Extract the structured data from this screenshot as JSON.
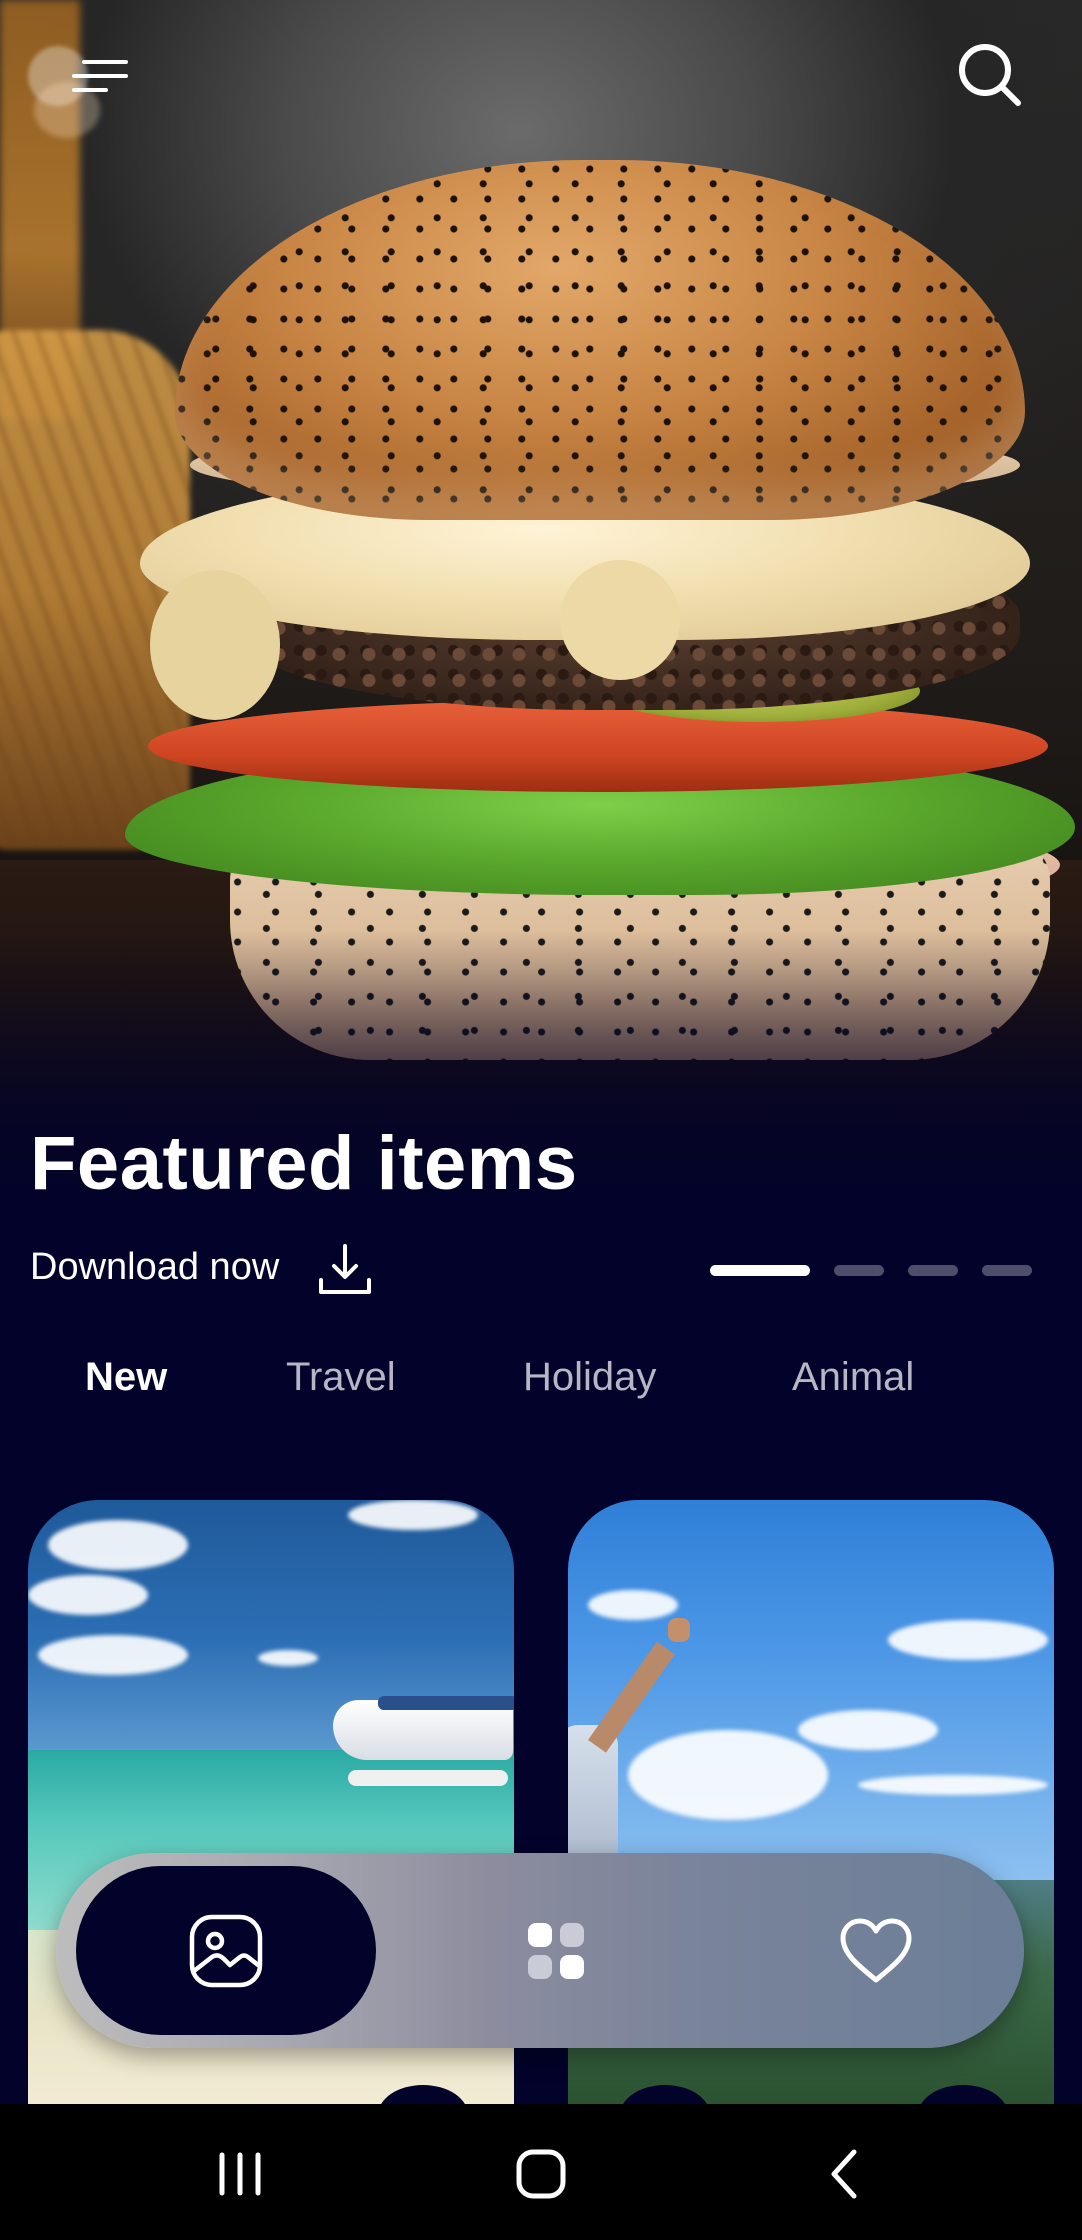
{
  "header": {
    "menu_icon": "menu-icon",
    "search_icon": "search-icon"
  },
  "hero": {
    "title": "Featured items",
    "download_label": "Download now",
    "download_icon": "download-icon",
    "carousel": {
      "total": 4,
      "active_index": 0
    }
  },
  "tabs": [
    {
      "label": "New",
      "active": true
    },
    {
      "label": "Travel",
      "active": false
    },
    {
      "label": "Holiday",
      "active": false
    },
    {
      "label": "Animal",
      "active": false
    }
  ],
  "cards": [
    {
      "image": "beach-seaplane-photo"
    },
    {
      "image": "mountain-cheer-photo"
    }
  ],
  "bottom_nav": [
    {
      "icon": "image-icon",
      "active": true
    },
    {
      "icon": "grid-icon",
      "active": false
    },
    {
      "icon": "heart-icon",
      "active": false
    }
  ],
  "system_nav": [
    "recents-icon",
    "home-icon",
    "back-icon"
  ],
  "colors": {
    "background": "#02022b",
    "text_primary": "#ffffff",
    "text_muted": "#b6b6c4",
    "nav_active": "#02022b"
  }
}
